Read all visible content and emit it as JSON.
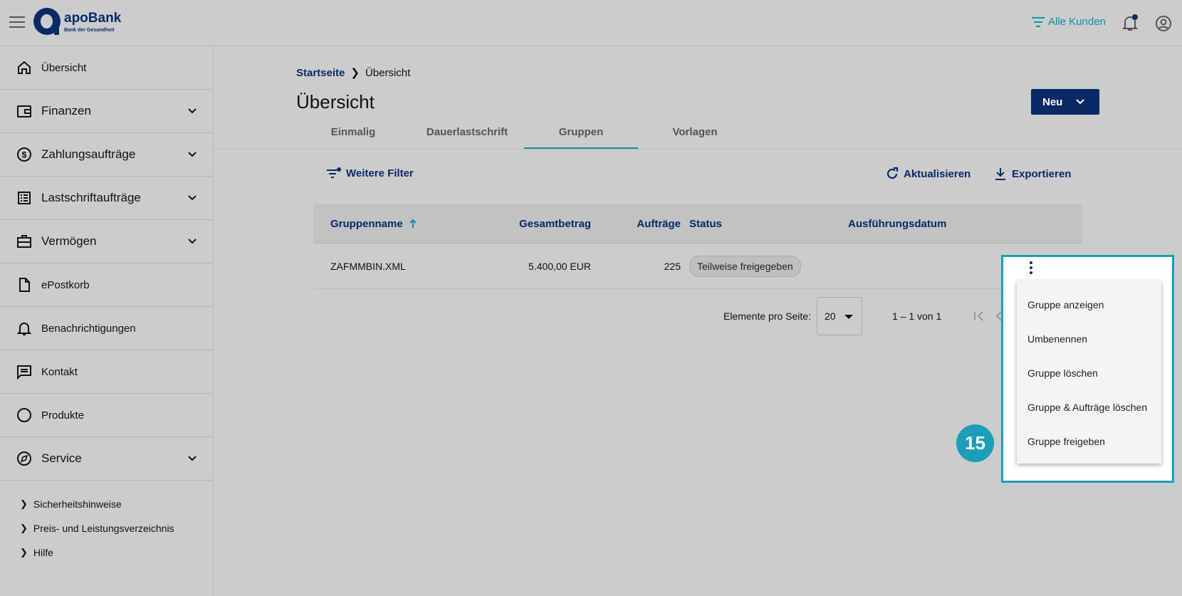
{
  "header": {
    "logo_name": "apoBank",
    "logo_sub": "Bank der Gesundheit",
    "customer_filter_label": "Alle Kunden"
  },
  "sidebar": {
    "items": [
      {
        "label": "Übersicht",
        "icon": "home-icon",
        "expandable": false
      },
      {
        "label": "Finanzen",
        "icon": "wallet-icon",
        "expandable": true
      },
      {
        "label": "Zahlungsaufträge",
        "icon": "dollar-circle-icon",
        "expandable": true
      },
      {
        "label": "Lastschriftaufträge",
        "icon": "list-box-icon",
        "expandable": true
      },
      {
        "label": "Vermögen",
        "icon": "briefcase-icon",
        "expandable": true
      },
      {
        "label": "ePostkorb",
        "icon": "document-icon",
        "expandable": false
      },
      {
        "label": "Benachrichtigungen",
        "icon": "bell-icon",
        "expandable": false
      },
      {
        "label": "Kontakt",
        "icon": "chat-icon",
        "expandable": false
      },
      {
        "label": "Produkte",
        "icon": "circle-icon",
        "expandable": false
      },
      {
        "label": "Service",
        "icon": "compass-icon",
        "expandable": true
      }
    ],
    "footer_links": [
      {
        "label": "Sicherheitshinweise"
      },
      {
        "label": "Preis- und Leistungsverzeichnis"
      },
      {
        "label": "Hilfe"
      }
    ]
  },
  "breadcrumb": {
    "home": "Startseite",
    "current": "Übersicht"
  },
  "page": {
    "title": "Übersicht",
    "new_button": "Neu"
  },
  "tabs": [
    {
      "label": "Einmalig"
    },
    {
      "label": "Dauerlastschrift"
    },
    {
      "label": "Gruppen",
      "active": true
    },
    {
      "label": "Vorlagen"
    }
  ],
  "toolbar": {
    "filter": "Weitere Filter",
    "refresh": "Aktualisieren",
    "export": "Exportieren"
  },
  "table": {
    "headers": [
      "Gruppenname",
      "Gesamtbetrag",
      "Aufträge",
      "Status",
      "Ausführungsdatum"
    ],
    "sort_column": "Gruppenname",
    "sort_direction": "ascending",
    "rows": [
      {
        "name": "ZAFMMBIN.XML",
        "amount": "5.400,00 EUR",
        "orders": "225",
        "status": "Teilweise freigegeben",
        "date": ""
      }
    ]
  },
  "pagination": {
    "per_page_label": "Elemente pro Seite:",
    "per_page": "20",
    "range": "1 – 1 von 1"
  },
  "context_menu": {
    "items": [
      {
        "label": "Gruppe anzeigen"
      },
      {
        "label": "Umbenennen"
      },
      {
        "label": "Gruppe löschen"
      },
      {
        "label": "Gruppe & Aufträge löschen"
      },
      {
        "label": "Gruppe freigeben"
      }
    ]
  },
  "step_marker": "15",
  "colors": {
    "brand": "#0a2a66",
    "accent": "#1590a8",
    "highlight": "#1aa0b8"
  }
}
